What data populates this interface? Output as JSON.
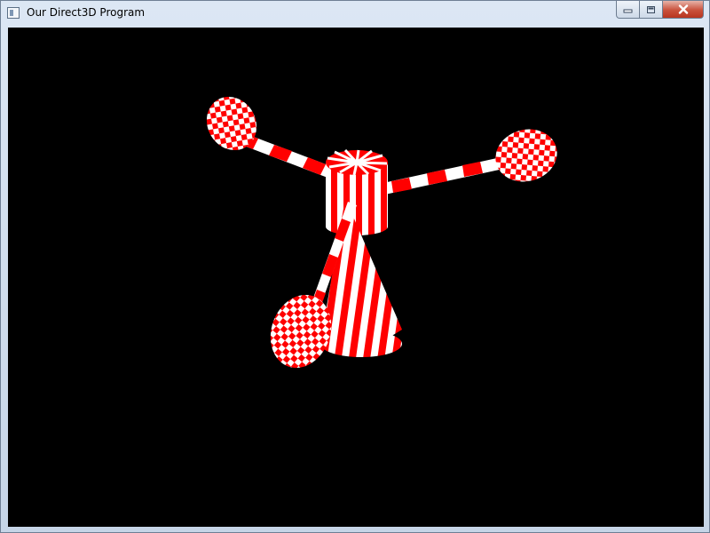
{
  "window": {
    "title": "Our Direct3D Program",
    "controls": {
      "minimize_icon": "minimize-icon",
      "maximize_icon": "maximize-icon",
      "close_icon": "close-icon"
    }
  },
  "scene": {
    "background_color": "#000000",
    "texture_colors": [
      "#ff0000",
      "#ffffff"
    ],
    "objects": [
      "central-cylinder",
      "cone",
      "rod-upper-left",
      "rod-right",
      "rod-lower",
      "sphere-upper-left",
      "sphere-right",
      "sphere-lower-left"
    ]
  }
}
